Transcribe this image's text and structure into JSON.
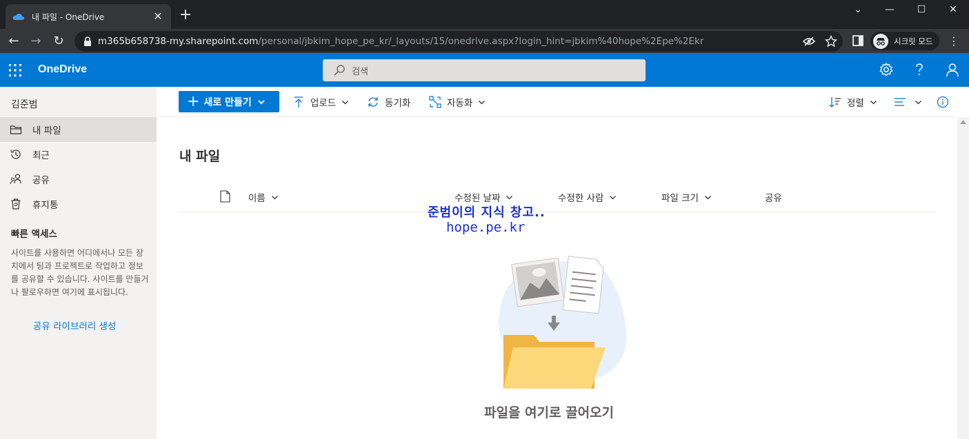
{
  "browser": {
    "tab_title": "내 파일 - OneDrive",
    "url_host": "m365b658738-my.sharepoint.com",
    "url_path": "/personal/jbkim_hope_pe_kr/_layouts/15/onedrive.aspx?login_hint=jbkim%40hope%2Epe%2Ekr",
    "incognito_label": "시크릿 모드"
  },
  "header": {
    "brand": "OneDrive",
    "search_placeholder": "검색"
  },
  "leftnav": {
    "user": "김준범",
    "items": [
      {
        "label": "내 파일",
        "icon": "folder-icon",
        "selected": true
      },
      {
        "label": "최근",
        "icon": "history-icon",
        "selected": false
      },
      {
        "label": "공유",
        "icon": "people-icon",
        "selected": false
      },
      {
        "label": "휴지통",
        "icon": "recycle-bin-icon",
        "selected": false
      }
    ],
    "quick_access_title": "빠른 액세스",
    "quick_access_desc": "사이트를 사용하면 어디에서나 모든 장치에서 팀과 프로젝트로 작업하고 정보를 공유할 수 있습니다. 사이트를 만들거나 팔로우하면 여기에 표시됩니다.",
    "create_library": "공유 라이브러리 생성"
  },
  "commandbar": {
    "new_label": "새로 만들기",
    "upload_label": "업로드",
    "sync_label": "동기화",
    "automate_label": "자동화",
    "sort_label": "정렬"
  },
  "main": {
    "title": "내 파일",
    "columns": {
      "name": "이름",
      "modified": "수정된 날짜",
      "modified_by": "수정한 사람",
      "size": "파일 크기",
      "sharing": "공유"
    },
    "watermark_line1": "준범이의 지식 창고..",
    "watermark_line2": "hope.pe.kr",
    "empty_text": "파일을 여기로 끌어오기"
  },
  "colors": {
    "brand_blue": "#0078d4",
    "chrome_dark": "#202124",
    "nav_bg": "#f3f2f1"
  }
}
